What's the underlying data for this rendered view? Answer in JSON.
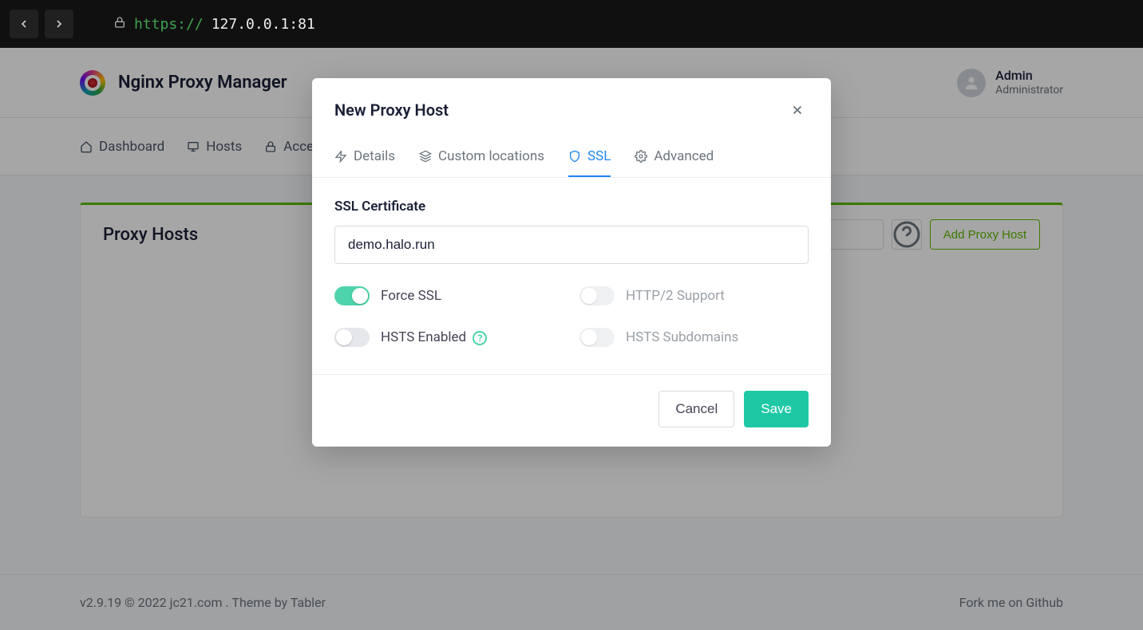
{
  "browser": {
    "scheme": "https://",
    "rest": "127.0.0.1:81"
  },
  "navbar": {
    "title": "Nginx Proxy Manager",
    "user_name": "Admin",
    "user_role": "Administrator"
  },
  "subnav": {
    "items": [
      {
        "label": "Dashboard"
      },
      {
        "label": "Hosts"
      },
      {
        "label": "Access Lists"
      }
    ]
  },
  "card": {
    "title": "Proxy Hosts",
    "add_label": "Add Proxy Host"
  },
  "footer": {
    "version": "v2.9.19 © 2022 ",
    "link1": "jc21.com",
    "theme_by": ". Theme by ",
    "link2": "Tabler",
    "fork": "Fork me on Github"
  },
  "modal": {
    "title": "New Proxy Host",
    "tabs": {
      "details": "Details",
      "custom_locations": "Custom locations",
      "ssl": "SSL",
      "advanced": "Advanced"
    },
    "ssl": {
      "cert_label": "SSL Certificate",
      "cert_value": "demo.halo.run",
      "force_ssl_label": "Force SSL",
      "force_ssl_on": true,
      "http2_label": "HTTP/2 Support",
      "http2_on": false,
      "hsts_label": "HSTS Enabled",
      "hsts_on": false,
      "hsts_sub_label": "HSTS Subdomains",
      "hsts_sub_on": false
    },
    "buttons": {
      "cancel": "Cancel",
      "save": "Save"
    }
  }
}
